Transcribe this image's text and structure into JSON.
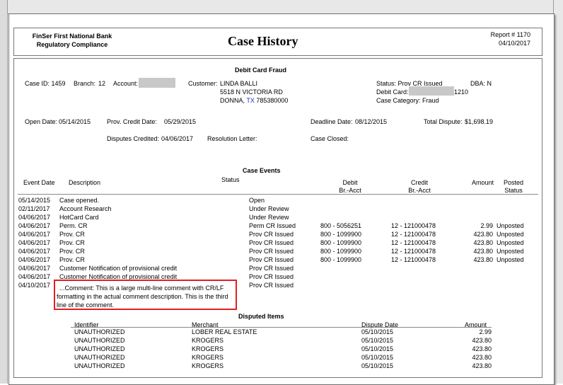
{
  "header": {
    "bank_line1": "FinSer First National Bank",
    "bank_line2": "Regulatory Compliance",
    "title": "Case History",
    "report_number": "Report # 1170",
    "report_date": "04/10/2017"
  },
  "case": {
    "section_title": "Debit Card Fraud",
    "case_id": "Case ID: 1459",
    "branch_label": "Branch:",
    "branch_value": "12",
    "account_label": "Account:",
    "customer_label": "Customer:",
    "customer_name": "LINDA BALLI",
    "customer_address": "5518 N VICTORIA RD",
    "customer_city": "DONNA,",
    "customer_state": "TX",
    "customer_zip": "785380000",
    "status": "Status: Prov CR Issued",
    "debit_card_label": "Debit Card:",
    "debit_card_last": "1210",
    "case_category": "Case Category: Fraud",
    "dba": "DBA: N",
    "open_date_label": "Open Date:",
    "open_date": "05/14/2015",
    "prov_credit_label": "Prov. Credit Date:",
    "prov_credit_date": "05/29/2015",
    "deadline_label": "Deadline Date:",
    "deadline_date": "08/12/2015",
    "total_dispute_label": "Total Dispute:",
    "total_dispute": "$1,698.19",
    "disputes_credited_label": "Disputes Credited:",
    "disputes_credited": "04/06/2017",
    "resolution_letter_label": "Resolution Letter:",
    "case_closed_label": "Case Closed:"
  },
  "events": {
    "section_title": "Case Events",
    "headers": {
      "event_date": "Event Date",
      "description": "Description",
      "status": "Status",
      "debit": "Debit",
      "debit_sub": "Br.-Acct",
      "credit": "Credit",
      "credit_sub": "Br.-Acct",
      "amount": "Amount",
      "posted": "Posted",
      "posted_sub": "Status"
    },
    "rows": [
      {
        "date": "05/14/2015",
        "desc": "Case opened.",
        "status": "Open",
        "debit": "",
        "credit": "",
        "amount": "",
        "posted": ""
      },
      {
        "date": "02/11/2017",
        "desc": "Account Research",
        "status": "Under Review",
        "debit": "",
        "credit": "",
        "amount": "",
        "posted": ""
      },
      {
        "date": "04/06/2017",
        "desc": "HotCard Card",
        "status": "Under Review",
        "debit": "",
        "credit": "",
        "amount": "",
        "posted": ""
      },
      {
        "date": "04/06/2017",
        "desc": "Perm. CR",
        "status": "Perm CR Issued",
        "debit": "800 - 5056251",
        "credit": "12 - 121000478",
        "amount": "2.99",
        "posted": "Unposted"
      },
      {
        "date": "04/06/2017",
        "desc": "Prov. CR",
        "status": "Prov CR Issued",
        "debit": "800 - 1099900",
        "credit": "12 - 121000478",
        "amount": "423.80",
        "posted": "Unposted"
      },
      {
        "date": "04/06/2017",
        "desc": "Prov. CR",
        "status": "Prov CR Issued",
        "debit": "800 - 1099900",
        "credit": "12 - 121000478",
        "amount": "423.80",
        "posted": "Unposted"
      },
      {
        "date": "04/06/2017",
        "desc": "Prov. CR",
        "status": "Prov CR Issued",
        "debit": "800 - 1099900",
        "credit": "12 - 121000478",
        "amount": "423.80",
        "posted": "Unposted"
      },
      {
        "date": "04/06/2017",
        "desc": "Prov. CR",
        "status": "Prov CR Issued",
        "debit": "800 - 1099900",
        "credit": "12 - 121000478",
        "amount": "423.80",
        "posted": "Unposted"
      },
      {
        "date": "04/06/2017",
        "desc": "Customer Notification of provisional credit",
        "status": "Prov CR Issued",
        "debit": "",
        "credit": "",
        "amount": "",
        "posted": ""
      },
      {
        "date": "04/06/2017",
        "desc": "Customer Notification of provisional credit",
        "status": "Prov CR Issued",
        "debit": "",
        "credit": "",
        "amount": "",
        "posted": ""
      },
      {
        "date": "04/10/2017",
        "desc": "",
        "status": "Prov CR Issued",
        "debit": "",
        "credit": "",
        "amount": "",
        "posted": ""
      }
    ],
    "comment_line1": "...Comment: This is a large multi-line comment with CR/LF",
    "comment_line2": "formatting in the actual comment description.  This is the third",
    "comment_line3": "line of the comment."
  },
  "disputed": {
    "section_title": "Disputed Items",
    "headers": {
      "identifier": "Identifier",
      "merchant": "Merchant",
      "dispute_date": "Dispute Date",
      "amount": "Amount"
    },
    "rows": [
      {
        "identifier": "UNAUTHORIZED",
        "merchant": "LOBER REAL ESTATE",
        "date": "05/10/2015",
        "amount": "2.99"
      },
      {
        "identifier": "UNAUTHORIZED",
        "merchant": "KROGERS",
        "date": "05/10/2015",
        "amount": "423.80"
      },
      {
        "identifier": "UNAUTHORIZED",
        "merchant": "KROGERS",
        "date": "05/10/2015",
        "amount": "423.80"
      },
      {
        "identifier": "UNAUTHORIZED",
        "merchant": "KROGERS",
        "date": "05/10/2015",
        "amount": "423.80"
      },
      {
        "identifier": "UNAUTHORIZED",
        "merchant": "KROGERS",
        "date": "05/10/2015",
        "amount": "423.80"
      }
    ]
  },
  "colors": {
    "highlight_border": "#e02020",
    "state_link": "#1a2fbf"
  }
}
